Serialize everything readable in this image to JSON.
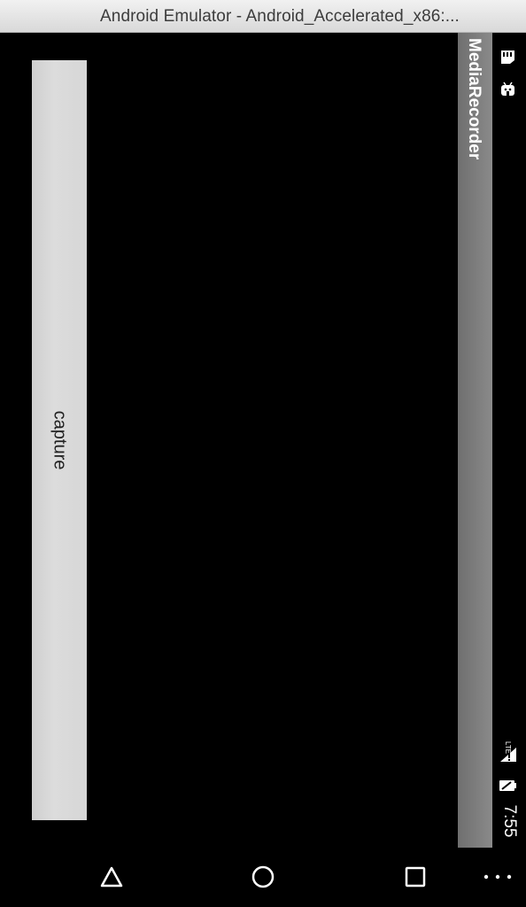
{
  "window": {
    "title": "Android Emulator - Android_Accelerated_x86:..."
  },
  "action_bar": {
    "title": "MediaRecorder",
    "color": "#7c7c7c"
  },
  "main": {
    "capture_label": "capture"
  },
  "status_bar": {
    "time": "7:55",
    "network_label": "LTE",
    "icons": [
      "sd-card-icon",
      "android-debug-icon",
      "lte-signal-icon",
      "battery-icon"
    ]
  },
  "nav_bar": {
    "buttons": [
      "back-icon",
      "home-icon",
      "recents-icon",
      "more-options-icon"
    ]
  }
}
